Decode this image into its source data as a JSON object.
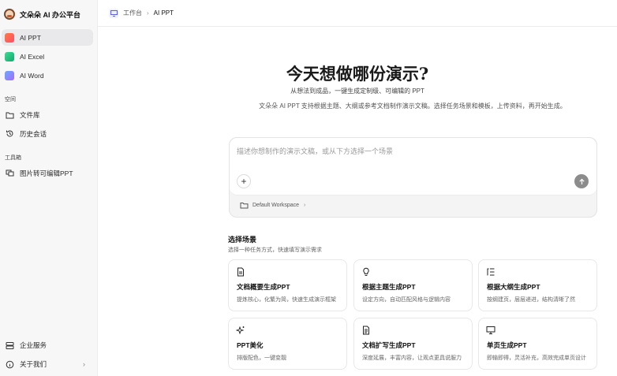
{
  "brand": {
    "name": "文朵朵 AI 办公平台"
  },
  "sidebar": {
    "apps": [
      {
        "label": "AI PPT",
        "active": true,
        "icon": "ppt-app-icon"
      },
      {
        "label": "AI Excel",
        "active": false,
        "icon": "excel-app-icon"
      },
      {
        "label": "AI Word",
        "active": false,
        "icon": "word-app-icon"
      }
    ],
    "space_label": "空间",
    "space_items": [
      {
        "label": "文件库",
        "icon": "folder-icon"
      },
      {
        "label": "历史会话",
        "icon": "history-icon"
      }
    ],
    "tools_label": "工具箱",
    "tools_items": [
      {
        "label": "图片转可编辑PPT",
        "icon": "image-convert-icon"
      }
    ],
    "bottom": [
      {
        "label": "企业服务",
        "icon": "server-icon"
      },
      {
        "label": "关于我们",
        "icon": "info-icon"
      }
    ]
  },
  "topbar": {
    "breadcrumb": [
      "工作台",
      "AI PPT"
    ]
  },
  "hero": {
    "title": "今天想做哪份演示?",
    "subtitle": "从想法到成品，一键生成定制级、可编辑的 PPT",
    "description": "文朵朵 AI PPT 支持根据主题、大纲或参考文档制作演示文稿。选择任务场景和模板，上传资料，再开始生成。"
  },
  "composer": {
    "placeholder": "描述你想制作的演示文稿，或从下方选择一个场景",
    "workspace": "Default Workspace"
  },
  "scenes": {
    "title": "选择场景",
    "subtitle": "选择一种任务方式，快速填写演示需求",
    "cards": [
      {
        "title": "文档概要生成PPT",
        "desc": "提炼核心，化繁为简，快速生成演示框架",
        "icon": "document-icon"
      },
      {
        "title": "根据主题生成PPT",
        "desc": "设定方向，自动匹配风格与逻辑内容",
        "icon": "lightbulb-icon"
      },
      {
        "title": "根据大纲生成PPT",
        "desc": "按纲建页，层层递进，结构清晰了然",
        "icon": "outline-list-icon"
      },
      {
        "title": "PPT美化",
        "desc": "排版配色，一键变靓",
        "icon": "sparkle-icon"
      },
      {
        "title": "文档扩写生成PPT",
        "desc": "深度延展，丰富内容，让观点更具说服力",
        "icon": "document-expand-icon"
      },
      {
        "title": "单页生成PPT",
        "desc": "即输即得，灵活补充，高效完成单页设计",
        "icon": "monitor-icon"
      }
    ]
  },
  "colors": {
    "accent_ppt": "#ff5a5f",
    "send_button": "#8c8c8c",
    "sidebar_bg": "#f7f7f8"
  }
}
